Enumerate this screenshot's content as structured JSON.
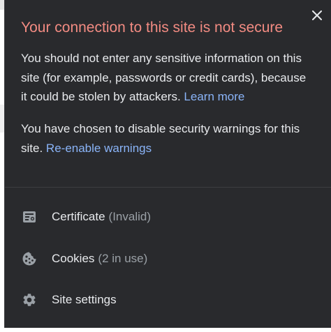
{
  "popup": {
    "title": "Your connection to this site is not secure",
    "close_label": "Close",
    "warning_text": "You should not enter any sensitive information on this site (for example, passwords or credit cards), because it could be stolen by attackers.",
    "learn_more": "Learn more",
    "disabled_text": "You have chosen to disable security warnings for this site.",
    "reenable_link": "Re-enable warnings",
    "items": [
      {
        "label": "Certificate",
        "sub": "(Invalid)",
        "icon": "certificate-icon"
      },
      {
        "label": "Cookies",
        "sub": "(2 in use)",
        "icon": "cookie-icon"
      },
      {
        "label": "Site settings",
        "sub": "",
        "icon": "gear-icon"
      }
    ]
  },
  "colors": {
    "background": "#292a2d",
    "title": "#f28b82",
    "text": "#e8eaed",
    "link": "#8ab4f8",
    "muted": "#9aa0a6"
  }
}
